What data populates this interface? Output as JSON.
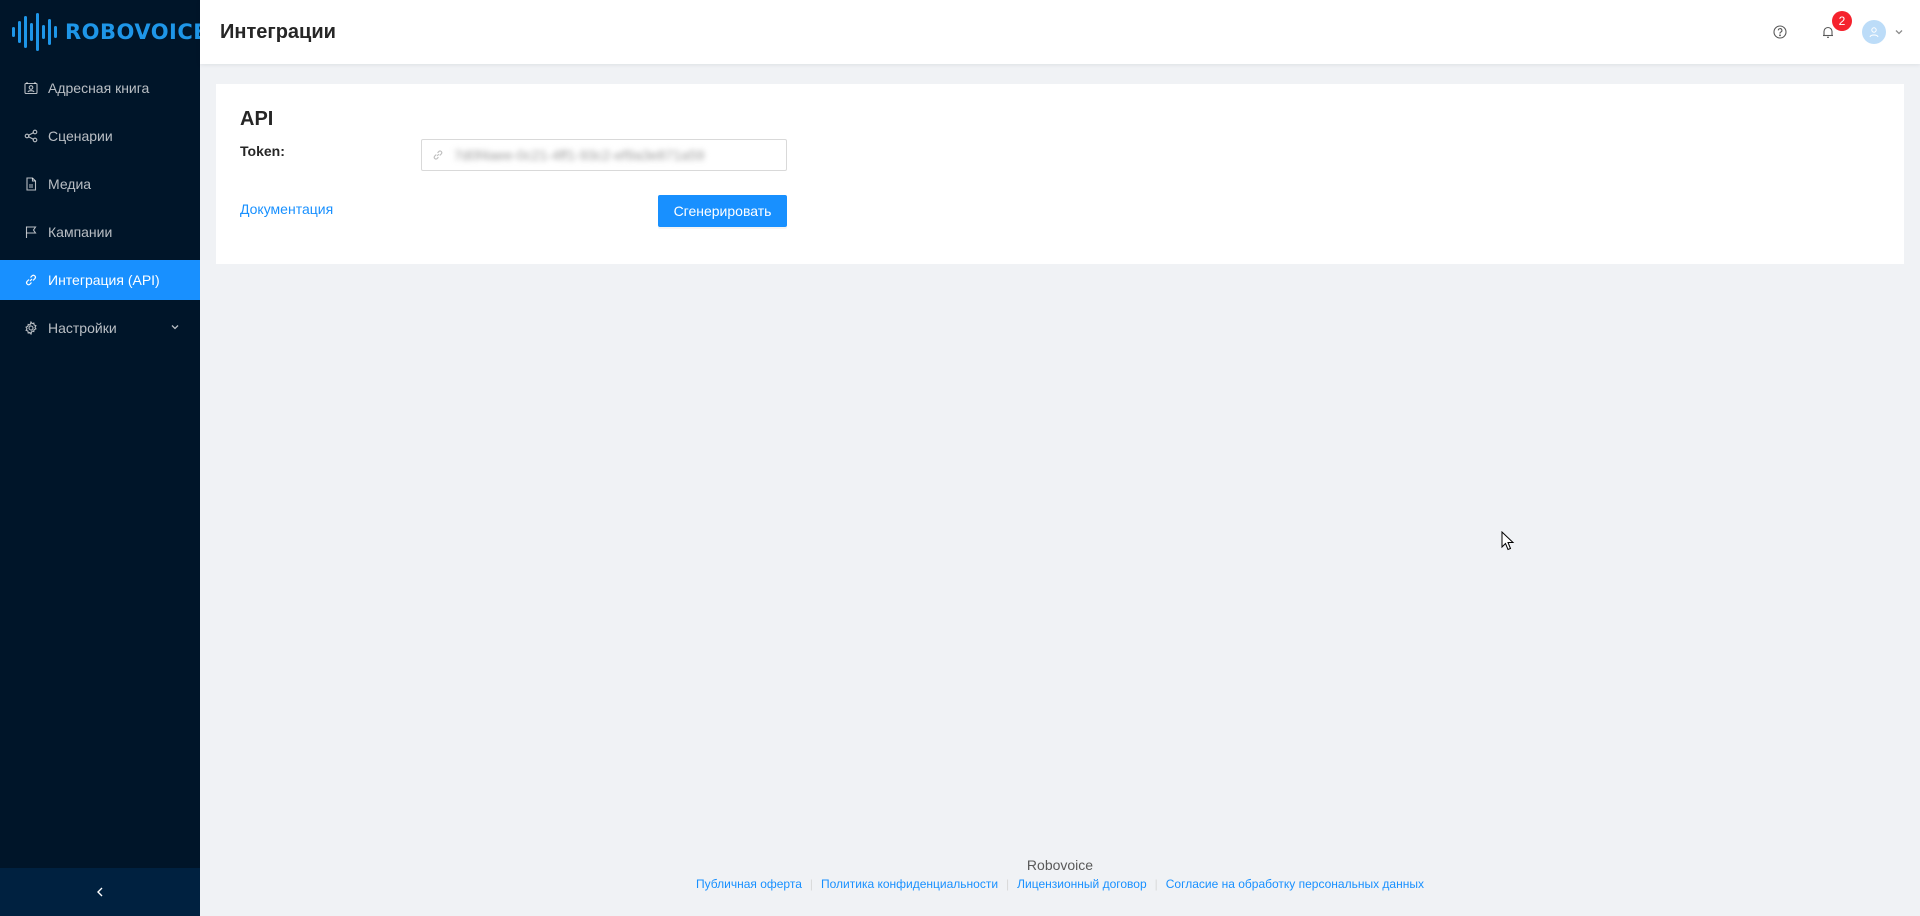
{
  "app": {
    "logo_text": "ROBOVOICE"
  },
  "sidebar": {
    "items": [
      {
        "label": "Адресная книга",
        "icon": "contacts-icon",
        "active": false
      },
      {
        "label": "Сценарии",
        "icon": "share-icon",
        "active": false
      },
      {
        "label": "Медиа",
        "icon": "file-icon",
        "active": false
      },
      {
        "label": "Кампании",
        "icon": "flag-icon",
        "active": false
      },
      {
        "label": "Интеграция (API)",
        "icon": "link-icon",
        "active": true
      },
      {
        "label": "Настройки",
        "icon": "gear-icon",
        "active": false,
        "has_submenu": true
      }
    ]
  },
  "header": {
    "title": "Интеграции",
    "notifications_count": "2"
  },
  "api_card": {
    "title": "API",
    "token_label": "Token:",
    "token_value": "7d0f4aee-0c21-4ff1-93c2-ef9a3e871a59",
    "docs_link": "Документация",
    "generate_button": "Сгенерировать"
  },
  "footer": {
    "brand": "Robovoice",
    "links": [
      "Публичная оферта",
      "Политика конфиденциальности",
      "Лицензионный договор",
      "Согласие на обработку персональных данных"
    ]
  },
  "colors": {
    "sidebar_bg": "#001529",
    "accent": "#1890ff",
    "brand": "#1e96e8",
    "page_bg": "#f0f2f5",
    "badge": "#f5222d"
  }
}
